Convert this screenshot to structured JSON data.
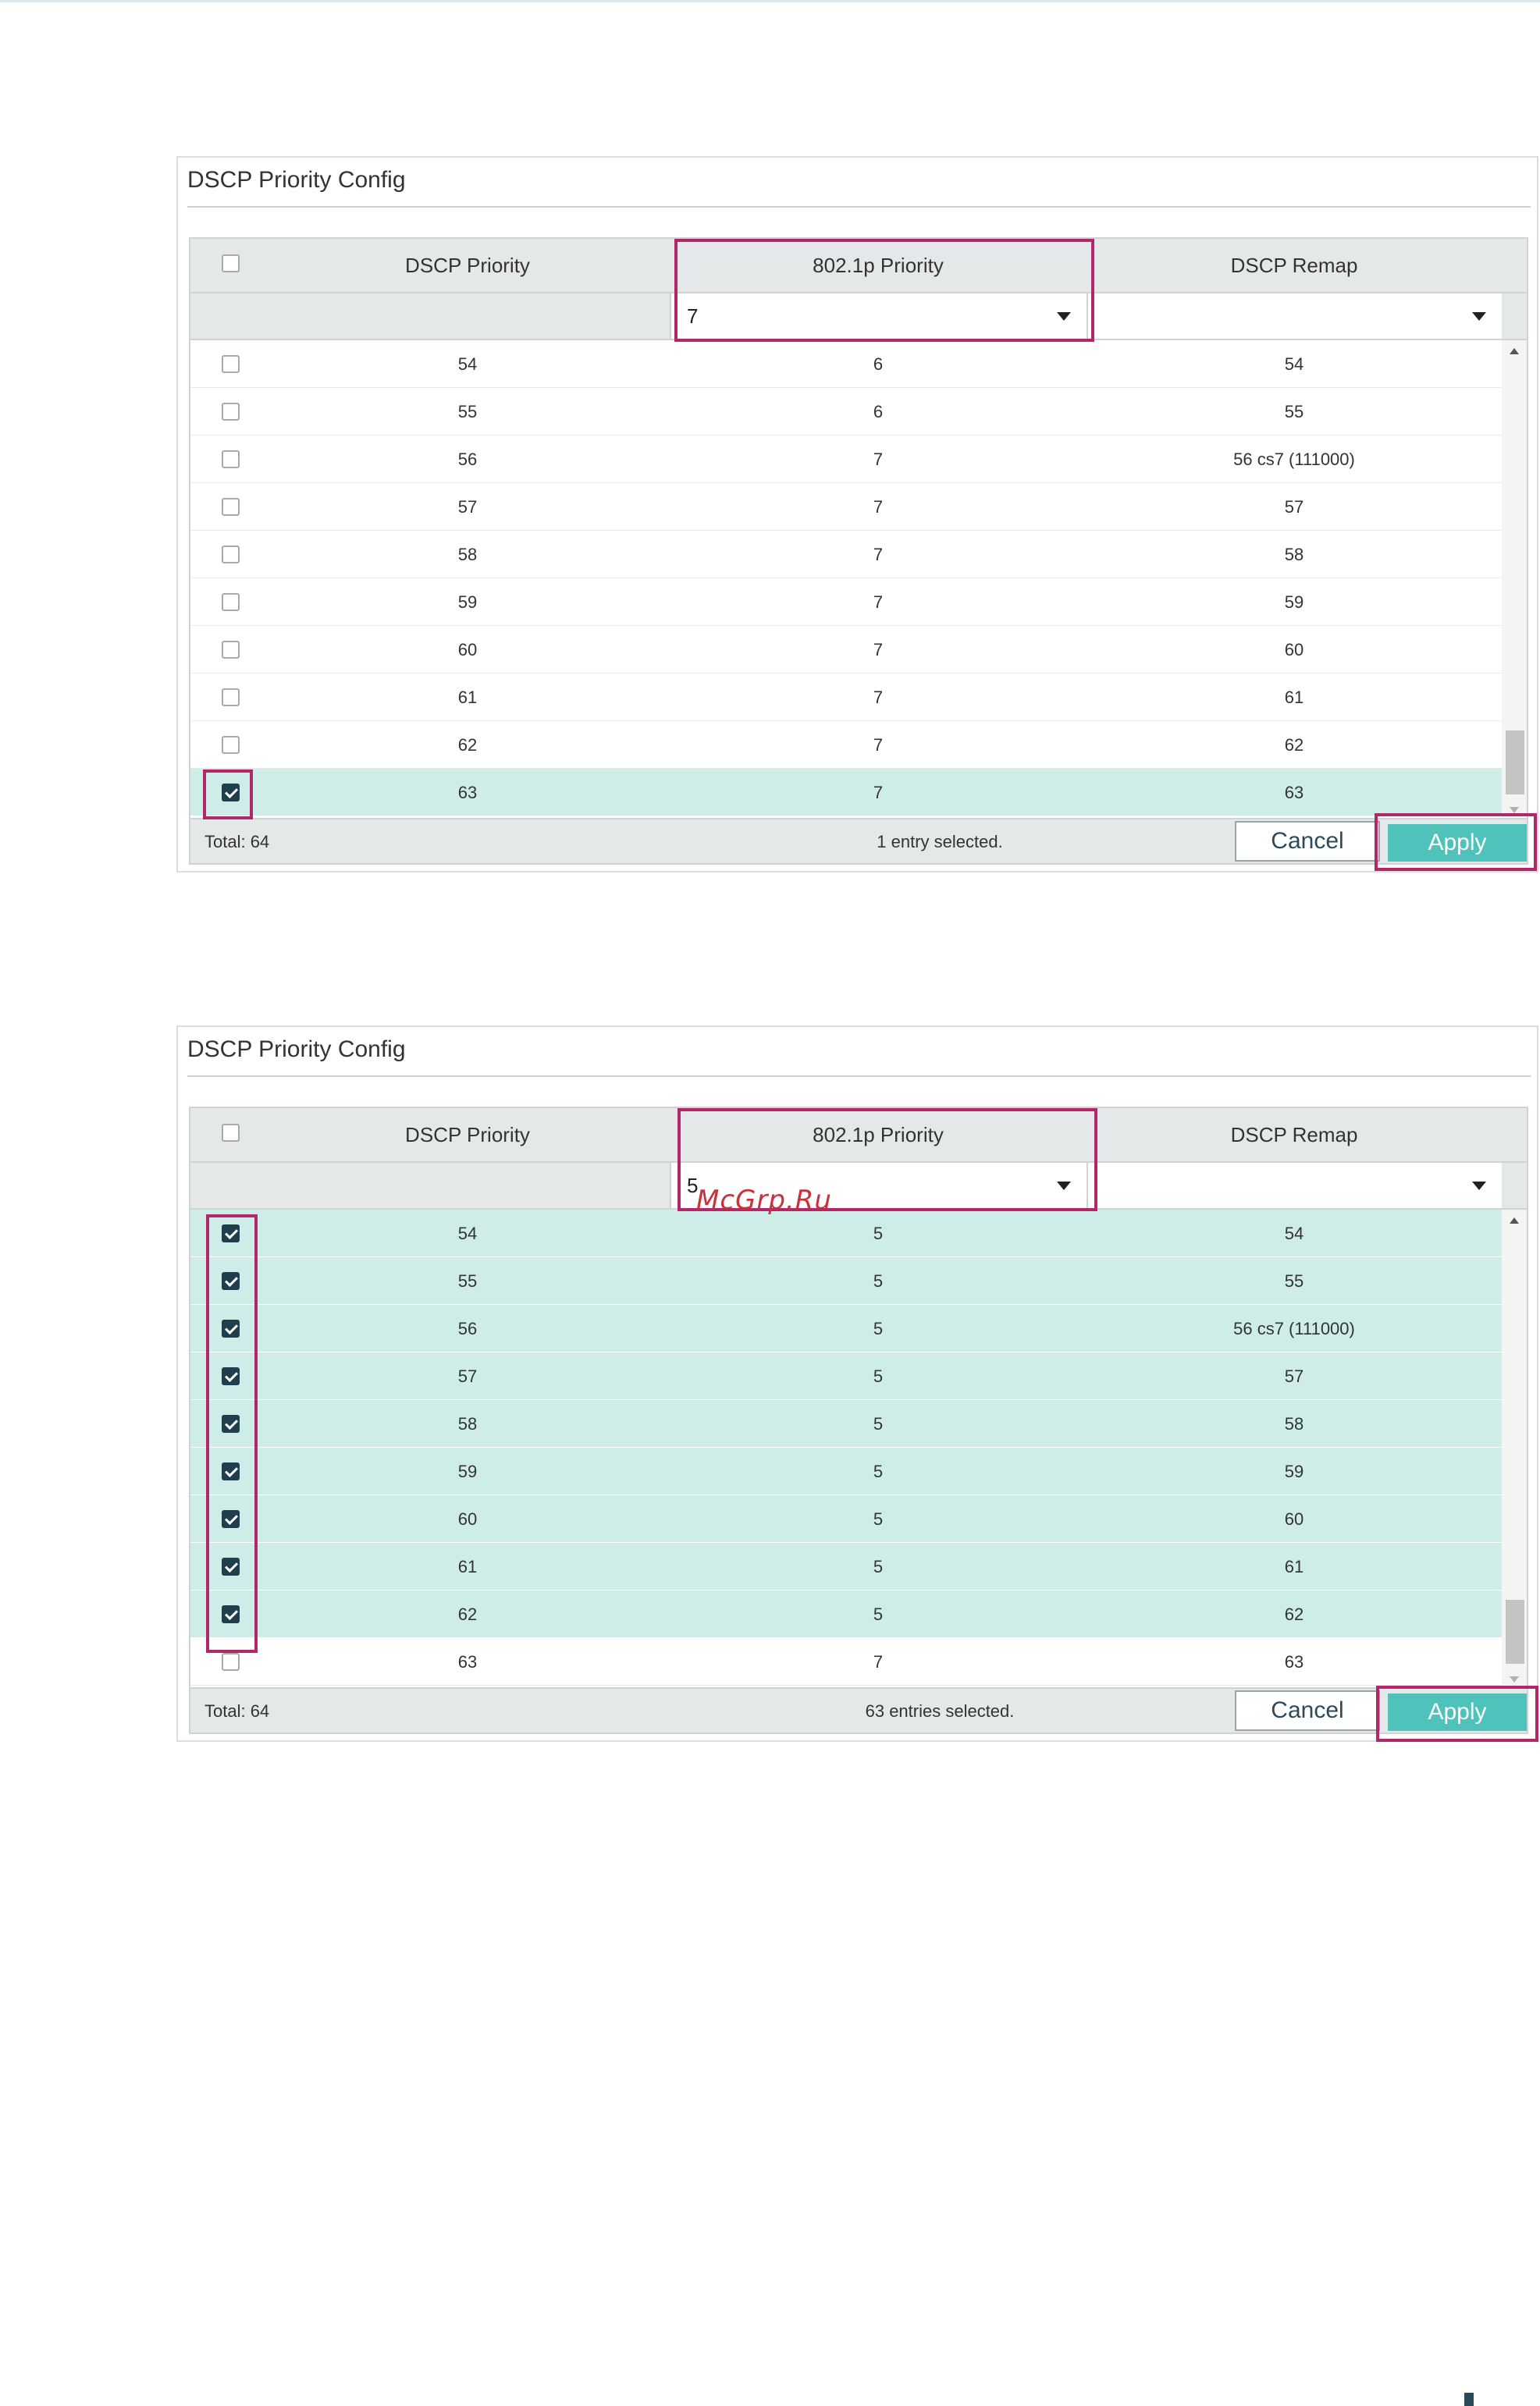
{
  "columns": {
    "dscp": "DSCP Priority",
    "dot1p": "802.1p Priority",
    "remap": "DSCP Remap"
  },
  "panels": [
    {
      "title": "DSCP Priority Config",
      "filter_value": "7",
      "rows": [
        {
          "dscp": "54",
          "dot1p": "6",
          "remap": "54",
          "checked": false
        },
        {
          "dscp": "55",
          "dot1p": "6",
          "remap": "55",
          "checked": false
        },
        {
          "dscp": "56",
          "dot1p": "7",
          "remap": "56 cs7 (111000)",
          "checked": false
        },
        {
          "dscp": "57",
          "dot1p": "7",
          "remap": "57",
          "checked": false
        },
        {
          "dscp": "58",
          "dot1p": "7",
          "remap": "58",
          "checked": false
        },
        {
          "dscp": "59",
          "dot1p": "7",
          "remap": "59",
          "checked": false
        },
        {
          "dscp": "60",
          "dot1p": "7",
          "remap": "60",
          "checked": false
        },
        {
          "dscp": "61",
          "dot1p": "7",
          "remap": "61",
          "checked": false
        },
        {
          "dscp": "62",
          "dot1p": "7",
          "remap": "62",
          "checked": false
        },
        {
          "dscp": "63",
          "dot1p": "7",
          "remap": "63",
          "checked": true
        }
      ],
      "total": "Total: 64",
      "selected": "1 entry selected.",
      "cancel_label": "Cancel",
      "apply_label": "Apply"
    },
    {
      "title": "DSCP Priority Config",
      "filter_value": "5",
      "rows": [
        {
          "dscp": "54",
          "dot1p": "5",
          "remap": "54",
          "checked": true
        },
        {
          "dscp": "55",
          "dot1p": "5",
          "remap": "55",
          "checked": true
        },
        {
          "dscp": "56",
          "dot1p": "5",
          "remap": "56 cs7 (111000)",
          "checked": true
        },
        {
          "dscp": "57",
          "dot1p": "5",
          "remap": "57",
          "checked": true
        },
        {
          "dscp": "58",
          "dot1p": "5",
          "remap": "58",
          "checked": true
        },
        {
          "dscp": "59",
          "dot1p": "5",
          "remap": "59",
          "checked": true
        },
        {
          "dscp": "60",
          "dot1p": "5",
          "remap": "60",
          "checked": true
        },
        {
          "dscp": "61",
          "dot1p": "5",
          "remap": "61",
          "checked": true
        },
        {
          "dscp": "62",
          "dot1p": "5",
          "remap": "62",
          "checked": true
        },
        {
          "dscp": "63",
          "dot1p": "7",
          "remap": "63",
          "checked": false
        }
      ],
      "total": "Total: 64",
      "selected": "63 entries selected.",
      "cancel_label": "Cancel",
      "apply_label": "Apply"
    }
  ],
  "watermark": "McGrp.Ru",
  "colors": {
    "highlight": "#b2266a",
    "apply": "#4fc3bb",
    "selected_row": "#cfede8",
    "checkbox_checked": "#1f3f4f"
  }
}
